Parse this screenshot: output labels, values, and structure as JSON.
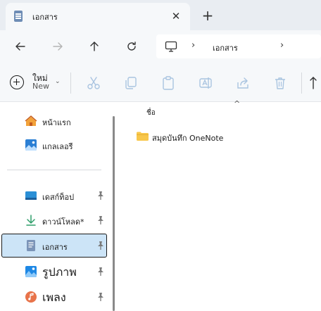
{
  "tab": {
    "title": "เอกสาร",
    "close_glyph": "✕",
    "new_tab_glyph": "+"
  },
  "address": {
    "path": "เอกสาร",
    "separator": "›",
    "expand": "›"
  },
  "commandbar": {
    "new_label": "ใหม่",
    "new_label_en": "New",
    "new_chevron": "⌄"
  },
  "sidebar": {
    "items": [
      {
        "label": "หน้าแรก",
        "icon": "home-icon",
        "pinned": false
      },
      {
        "label": "แกลเลอรี",
        "icon": "gallery-icon",
        "pinned": false
      },
      {
        "label": "เดสก์ท็อป",
        "icon": "desktop-icon",
        "pinned": true
      },
      {
        "label": "ดาวน์โหลด*",
        "icon": "download-icon",
        "pinned": true
      },
      {
        "label": "เอกสาร",
        "icon": "documents-icon",
        "pinned": true,
        "selected": true
      },
      {
        "label": "รูปภาพ",
        "icon": "pictures-icon",
        "pinned": true
      },
      {
        "label": "เพลง",
        "icon": "music-icon",
        "pinned": true
      }
    ]
  },
  "content": {
    "sort_glyph": "^",
    "column_name": "ชื่อ",
    "files": [
      {
        "name": "สมุดบันทึก OneNote",
        "icon": "folder-icon"
      }
    ]
  },
  "colors": {
    "accent": "#0067c0",
    "selected_bg": "#cce4f7",
    "chrome_bg": "#f6f8fa",
    "tabstrip_bg": "#e9edf2",
    "folder": "#f8c74b"
  }
}
